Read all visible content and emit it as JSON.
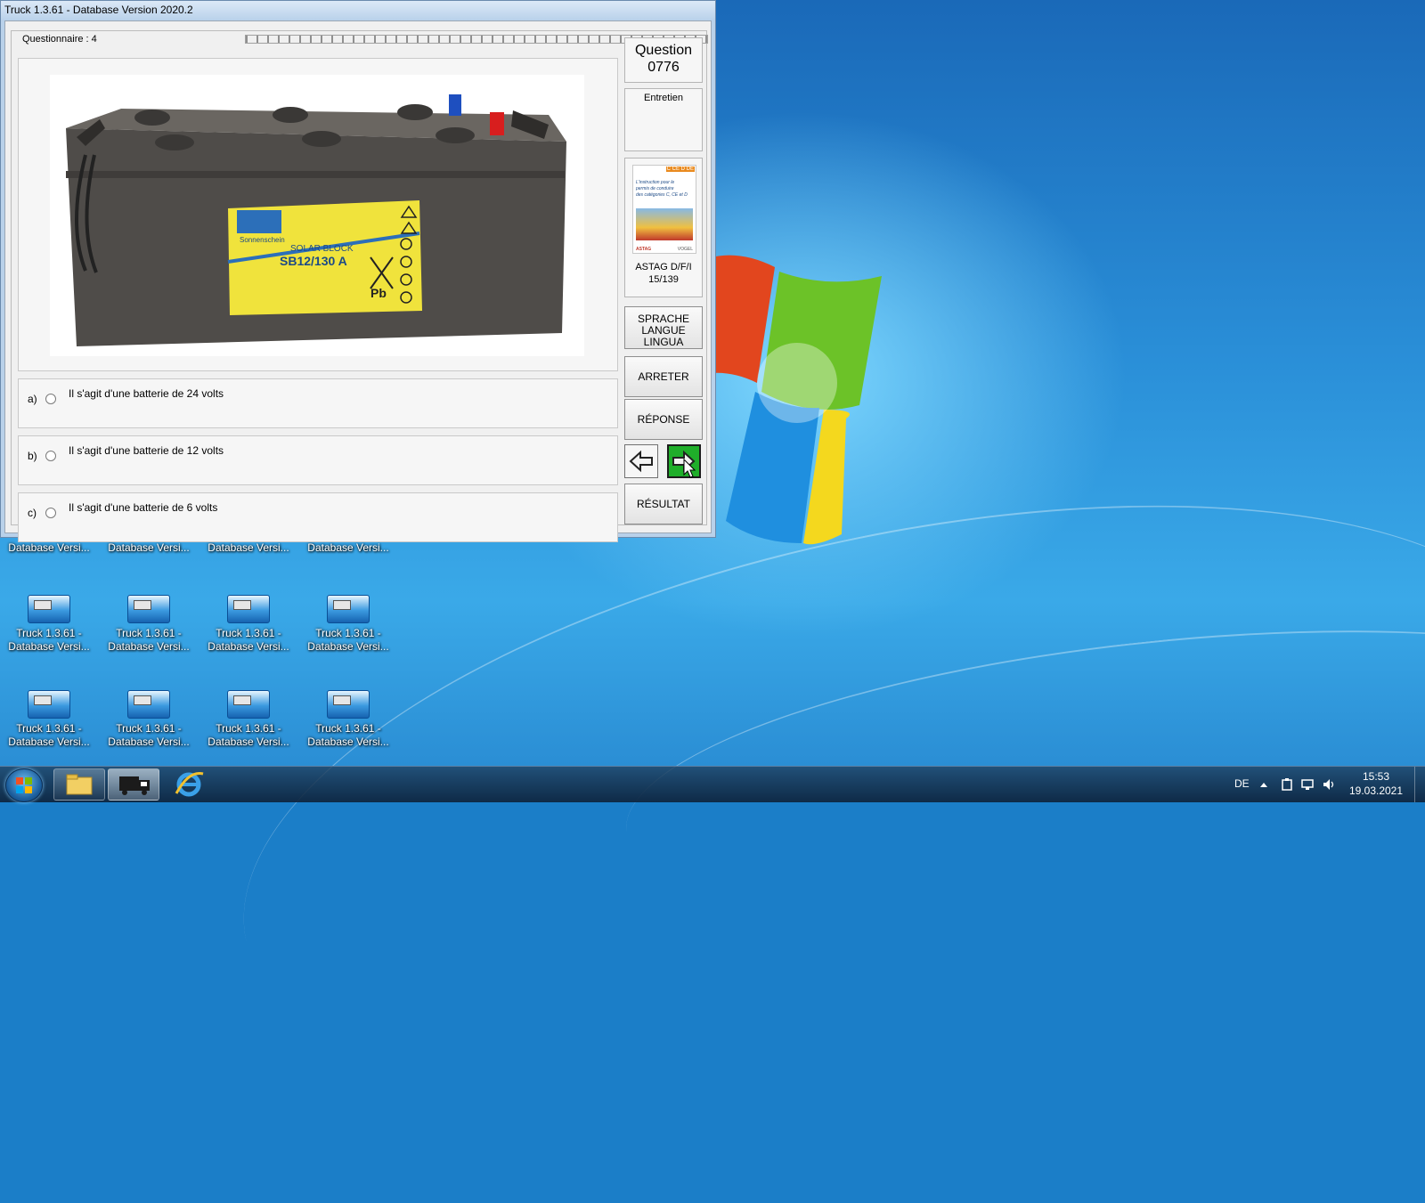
{
  "window": {
    "title": "Truck 1.3.61 - Database Version 2020.2",
    "questionnaire_label": "Questionnaire : 4"
  },
  "question": {
    "label": "Question",
    "number": "0776",
    "category": "Entretien",
    "source_line1": "ASTAG D/F/I",
    "source_line2": "15/139"
  },
  "book_cover": {
    "badge": "C CE D DE",
    "text_lines": [
      "L'instruction pour le",
      "permis de conduire",
      "des catégories C, CE et D"
    ],
    "footer_left": "ASTAG",
    "footer_right": "VOGEL"
  },
  "battery_label": {
    "brand": "Sonnenschein",
    "series": "SOLAR BLOCK",
    "model": "SB12/130 A",
    "pb": "Pb"
  },
  "answers": [
    {
      "letter": "a)",
      "text": "Il s'agit d'une batterie de 24 volts"
    },
    {
      "letter": "b)",
      "text": "Il s'agit d'une batterie de 12 volts"
    },
    {
      "letter": "c)",
      "text": "Il s'agit d'une batterie de 6 volts"
    }
  ],
  "buttons": {
    "language": [
      "SPRACHE",
      "LANGUE",
      "LINGUA"
    ],
    "stop": "ARRETER",
    "answer": "RÉPONSE",
    "result": "RÉSULTAT"
  },
  "desktop_icons": {
    "label_line1": "Truck 1.3.61 -",
    "label_line2": "Database Versi...",
    "count": 12
  },
  "taskbar": {
    "language": "DE",
    "time": "15:53",
    "date": "19.03.2021"
  },
  "colors": {
    "next_button": "#1fae2a",
    "title_bar": "#b9d1ea"
  }
}
